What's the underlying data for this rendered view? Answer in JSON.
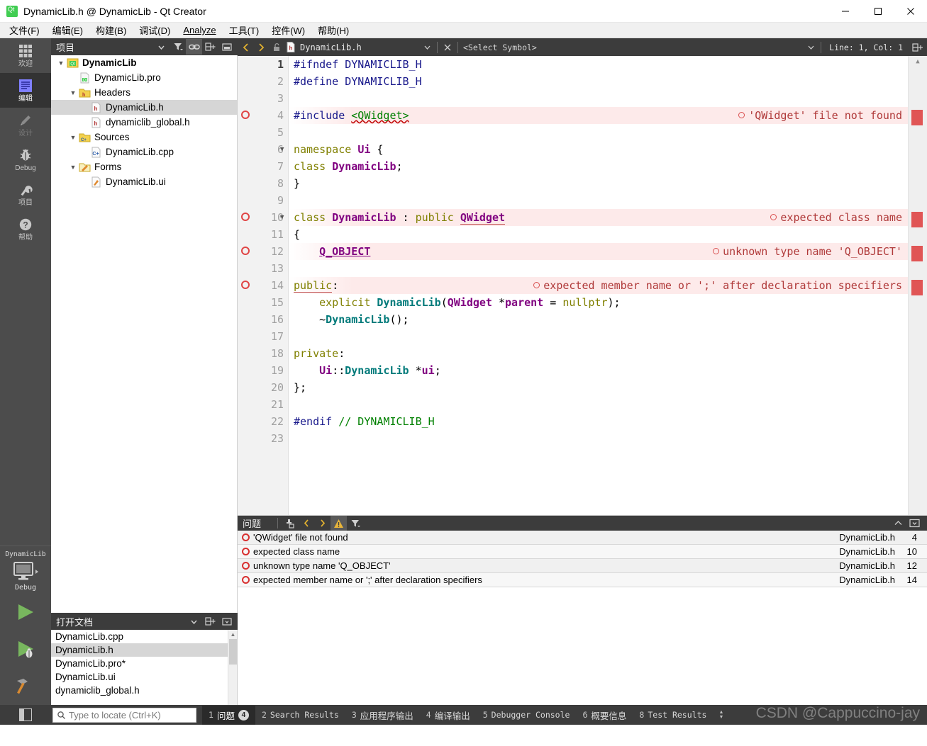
{
  "window": {
    "title": "DynamicLib.h @ DynamicLib - Qt Creator",
    "app_icon": "qt-logo-icon",
    "minimize": "minimize-icon",
    "maximize": "maximize-icon",
    "close": "close-icon"
  },
  "menubar": {
    "items": [
      {
        "label": "文件(F)",
        "mnemonic": "F"
      },
      {
        "label": "编辑(E)",
        "mnemonic": "E"
      },
      {
        "label": "构建(B)",
        "mnemonic": "B"
      },
      {
        "label": "调试(D)",
        "mnemonic": "D"
      },
      {
        "label": "Analyze",
        "mnemonic": "A"
      },
      {
        "label": "工具(T)",
        "mnemonic": "T"
      },
      {
        "label": "控件(W)",
        "mnemonic": "W"
      },
      {
        "label": "帮助(H)",
        "mnemonic": "H"
      }
    ]
  },
  "moderail": {
    "modes": [
      {
        "label": "欢迎",
        "icon": "grid-icon",
        "state": "normal"
      },
      {
        "label": "编辑",
        "icon": "document-lines-icon",
        "state": "active"
      },
      {
        "label": "设计",
        "icon": "pencil-icon",
        "state": "disabled"
      },
      {
        "label": "Debug",
        "icon": "bug-icon",
        "state": "normal"
      },
      {
        "label": "项目",
        "icon": "wrench-icon",
        "state": "normal"
      },
      {
        "label": "帮助",
        "icon": "question-mark-icon",
        "state": "normal"
      }
    ],
    "kit": {
      "project": "DynamicLib",
      "build_config": "Debug",
      "icon": "desktop-monitor-icon"
    },
    "run_button": "run-icon",
    "debug_button": "start-debugging-icon",
    "build_button": "build-hammer-icon"
  },
  "project_panel": {
    "title": "项目",
    "tools": [
      "chevron-down-icon",
      "filter-icon",
      "link-icon",
      "split-icon",
      "collapse-icon"
    ],
    "tree": [
      {
        "label": "DynamicLib",
        "depth": 0,
        "arrow": "down",
        "icon": "qt-project-icon",
        "bold": true,
        "selected": false
      },
      {
        "label": "DynamicLib.pro",
        "depth": 1,
        "arrow": "none",
        "icon": "pro-file-icon",
        "bold": false,
        "selected": false
      },
      {
        "label": "Headers",
        "depth": 1,
        "arrow": "down",
        "icon": "folder-h-icon",
        "bold": false,
        "selected": false
      },
      {
        "label": "DynamicLib.h",
        "depth": 2,
        "arrow": "none",
        "icon": "header-file-icon",
        "bold": false,
        "selected": true
      },
      {
        "label": "dynamiclib_global.h",
        "depth": 2,
        "arrow": "none",
        "icon": "header-file-icon",
        "bold": false,
        "selected": false
      },
      {
        "label": "Sources",
        "depth": 1,
        "arrow": "down",
        "icon": "folder-cpp-icon",
        "bold": false,
        "selected": false
      },
      {
        "label": "DynamicLib.cpp",
        "depth": 2,
        "arrow": "none",
        "icon": "cpp-file-icon",
        "bold": false,
        "selected": false
      },
      {
        "label": "Forms",
        "depth": 1,
        "arrow": "down",
        "icon": "folder-ui-icon",
        "bold": false,
        "selected": false
      },
      {
        "label": "DynamicLib.ui",
        "depth": 2,
        "arrow": "none",
        "icon": "ui-file-icon",
        "bold": false,
        "selected": false
      }
    ]
  },
  "open_documents": {
    "title": "打开文档",
    "tools": [
      "chevron-down-icon",
      "split-icon",
      "close-icon"
    ],
    "items": [
      {
        "label": "DynamicLib.cpp",
        "selected": false
      },
      {
        "label": "DynamicLib.h",
        "selected": true
      },
      {
        "label": "DynamicLib.pro*",
        "selected": false
      },
      {
        "label": "DynamicLib.ui",
        "selected": false
      },
      {
        "label": "dynamiclib_global.h",
        "selected": false
      }
    ]
  },
  "editor_toolbar": {
    "back": "back-arrow-icon",
    "forward": "forward-arrow-icon",
    "lock": "unlocked-padlock-icon",
    "file_icon": "header-file-icon",
    "file_name": "DynamicLib.h",
    "dropdown": "chevron-down-icon",
    "close": "close-icon",
    "symbol_selector": "<Select Symbol>",
    "symbol_dropdown": "chevron-down-icon",
    "line_col": "Line: 1, Col: 1",
    "split": "split-icon"
  },
  "editor": {
    "lines": [
      {
        "n": 1,
        "error": false,
        "fold": false,
        "tokens": [
          {
            "t": "#ifndef ",
            "c": "pre"
          },
          {
            "t": "DYNAMICLIB_H",
            "c": "pre"
          }
        ]
      },
      {
        "n": 2,
        "error": false,
        "fold": false,
        "tokens": [
          {
            "t": "#define ",
            "c": "pre"
          },
          {
            "t": "DYNAMICLIB_H",
            "c": "pre"
          }
        ]
      },
      {
        "n": 3,
        "error": false,
        "fold": false,
        "tokens": []
      },
      {
        "n": 4,
        "error": true,
        "fold": false,
        "annotation": "'QWidget' file not found",
        "tokens": [
          {
            "t": "#include ",
            "c": "pre"
          },
          {
            "t": "<QWidget>",
            "c": "str-err"
          }
        ]
      },
      {
        "n": 5,
        "error": false,
        "fold": false,
        "tokens": []
      },
      {
        "n": 6,
        "error": false,
        "fold": true,
        "tokens": [
          {
            "t": "namespace ",
            "c": "kw"
          },
          {
            "t": "Ui",
            "c": "type"
          },
          {
            "t": " {",
            "c": "plain"
          }
        ]
      },
      {
        "n": 7,
        "error": false,
        "fold": false,
        "tokens": [
          {
            "t": "class ",
            "c": "kw"
          },
          {
            "t": "DynamicLib",
            "c": "type"
          },
          {
            "t": ";",
            "c": "plain"
          }
        ]
      },
      {
        "n": 8,
        "error": false,
        "fold": false,
        "tokens": [
          {
            "t": "}",
            "c": "plain"
          }
        ]
      },
      {
        "n": 9,
        "error": false,
        "fold": false,
        "tokens": []
      },
      {
        "n": 10,
        "error": true,
        "fold": true,
        "annotation": "expected class name",
        "tokens": [
          {
            "t": "class ",
            "c": "kw"
          },
          {
            "t": "DynamicLib",
            "c": "type"
          },
          {
            "t": " : ",
            "c": "plain"
          },
          {
            "t": "public ",
            "c": "kw"
          },
          {
            "t": "QWidget",
            "c": "type-err"
          }
        ]
      },
      {
        "n": 11,
        "error": false,
        "fold": false,
        "tokens": [
          {
            "t": "{",
            "c": "plain"
          }
        ]
      },
      {
        "n": 12,
        "error": true,
        "fold": false,
        "annotation": "unknown type name 'Q_OBJECT'",
        "tokens": [
          {
            "t": "    ",
            "c": "plain"
          },
          {
            "t": "Q_OBJECT",
            "c": "macro-err"
          }
        ]
      },
      {
        "n": 13,
        "error": false,
        "fold": false,
        "tokens": []
      },
      {
        "n": 14,
        "error": true,
        "fold": false,
        "annotation": "expected member name or ';' after declaration specifiers",
        "tokens": [
          {
            "t": "public",
            "c": "kw-err"
          },
          {
            "t": ":",
            "c": "plain"
          }
        ]
      },
      {
        "n": 15,
        "error": false,
        "fold": false,
        "tokens": [
          {
            "t": "    explicit ",
            "c": "kw-ind"
          },
          {
            "t": "DynamicLib",
            "c": "typec"
          },
          {
            "t": "(",
            "c": "plain"
          },
          {
            "t": "QWidget",
            "c": "type"
          },
          {
            "t": " *",
            "c": "plain"
          },
          {
            "t": "parent",
            "c": "field"
          },
          {
            "t": " = ",
            "c": "plain"
          },
          {
            "t": "nullptr",
            "c": "kw"
          },
          {
            "t": ");",
            "c": "plain"
          }
        ]
      },
      {
        "n": 16,
        "error": false,
        "fold": false,
        "tokens": [
          {
            "t": "    ~",
            "c": "plain"
          },
          {
            "t": "DynamicLib",
            "c": "typec"
          },
          {
            "t": "();",
            "c": "plain"
          }
        ]
      },
      {
        "n": 17,
        "error": false,
        "fold": false,
        "tokens": []
      },
      {
        "n": 18,
        "error": false,
        "fold": false,
        "tokens": [
          {
            "t": "private",
            "c": "kw"
          },
          {
            "t": ":",
            "c": "plain"
          }
        ]
      },
      {
        "n": 19,
        "error": false,
        "fold": false,
        "tokens": [
          {
            "t": "    ",
            "c": "plain"
          },
          {
            "t": "Ui",
            "c": "type"
          },
          {
            "t": "::",
            "c": "plain"
          },
          {
            "t": "DynamicLib",
            "c": "typec"
          },
          {
            "t": " *",
            "c": "plain"
          },
          {
            "t": "ui",
            "c": "field"
          },
          {
            "t": ";",
            "c": "plain"
          }
        ]
      },
      {
        "n": 20,
        "error": false,
        "fold": false,
        "tokens": [
          {
            "t": "};",
            "c": "plain"
          }
        ]
      },
      {
        "n": 21,
        "error": false,
        "fold": false,
        "tokens": []
      },
      {
        "n": 22,
        "error": false,
        "fold": false,
        "tokens": [
          {
            "t": "#endif ",
            "c": "pre"
          },
          {
            "t": "// DYNAMICLIB_H",
            "c": "cmt"
          }
        ]
      },
      {
        "n": 23,
        "error": false,
        "fold": false,
        "tokens": []
      }
    ],
    "current_line": 1,
    "error_marker_lines": [
      4,
      10,
      12,
      14
    ],
    "scrollbar_up_icon": "chevron-up-icon"
  },
  "issues_panel": {
    "title": "问题",
    "tools": [
      "copy-icon",
      "prev-issue-icon",
      "next-issue-icon",
      "warning-filter-icon",
      "filter-icon"
    ],
    "right_tools": [
      "chevron-up-icon",
      "maximize-pane-icon"
    ],
    "columns": [
      "description",
      "file",
      "line"
    ],
    "rows": [
      {
        "severity": "error",
        "description": "'QWidget' file not found",
        "file": "DynamicLib.h",
        "line": "4"
      },
      {
        "severity": "error",
        "description": "expected class name",
        "file": "DynamicLib.h",
        "line": "10"
      },
      {
        "severity": "error",
        "description": "unknown type name 'Q_OBJECT'",
        "file": "DynamicLib.h",
        "line": "12"
      },
      {
        "severity": "error",
        "description": "expected member name or ';' after declaration specifiers",
        "file": "DynamicLib.h",
        "line": "14"
      }
    ]
  },
  "statusbar": {
    "sidebar_toggle": "sidebar-toggle-icon",
    "locator_placeholder": "Type to locate (Ctrl+K)",
    "locator_value": "",
    "search_icon": "search-icon",
    "tabs": [
      {
        "num": "1",
        "label": "问题",
        "badge": "4",
        "active": true,
        "cjk": true
      },
      {
        "num": "2",
        "label": "Search Results",
        "badge": "",
        "active": false,
        "cjk": false
      },
      {
        "num": "3",
        "label": "应用程序输出",
        "badge": "",
        "active": false,
        "cjk": true
      },
      {
        "num": "4",
        "label": "编译输出",
        "badge": "",
        "active": false,
        "cjk": true
      },
      {
        "num": "5",
        "label": "Debugger Console",
        "badge": "",
        "active": false,
        "cjk": false
      },
      {
        "num": "6",
        "label": "概要信息",
        "badge": "",
        "active": false,
        "cjk": true
      },
      {
        "num": "8",
        "label": "Test Results",
        "badge": "",
        "active": false,
        "cjk": false
      }
    ],
    "resize_handle": "updown-arrows-icon",
    "watermark": "CSDN @Cappuccino-jay"
  },
  "colors": {
    "dark_chrome": "#3c3c3c",
    "rail": "#4c4c4c",
    "rail_active": "#333333",
    "error_red": "#d83030",
    "error_bg": "#fdeaea",
    "accent_yellow": "#e8b53a",
    "qt_green": "#41cd52",
    "selection_gray": "#d6d6d6"
  }
}
